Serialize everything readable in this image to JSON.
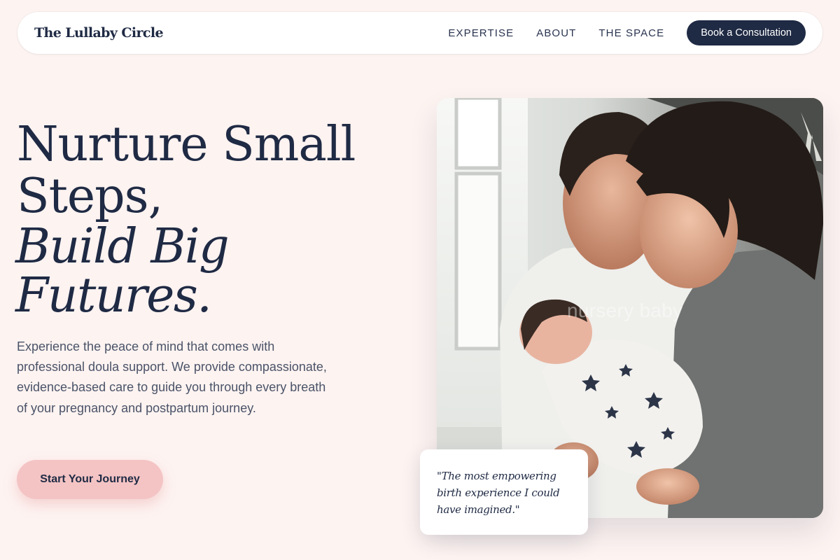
{
  "brand": {
    "name": "The Lullaby Circle"
  },
  "nav": {
    "links": [
      "EXPERTISE",
      "ABOUT",
      "THE SPACE"
    ],
    "cta_label": "Book a Consultation"
  },
  "hero": {
    "headline_line1": "Nurture Small Steps,",
    "headline_line2": "Build Big Futures.",
    "intro": "Experience the peace of mind that comes with professional doula support. We provide compassionate, evidence-based care to guide you through every breath of your pregnancy and postpartum journey.",
    "cta_label": "Start Your Journey"
  },
  "image": {
    "overlay_text": "nursery baby"
  },
  "testimonial": {
    "quote": "\"The most empowering birth experience I could have imagined.\""
  },
  "colors": {
    "background": "#fdf3f1",
    "navy": "#1f2a44",
    "blush": "#f4c4c4",
    "body_text": "#4a5368"
  }
}
